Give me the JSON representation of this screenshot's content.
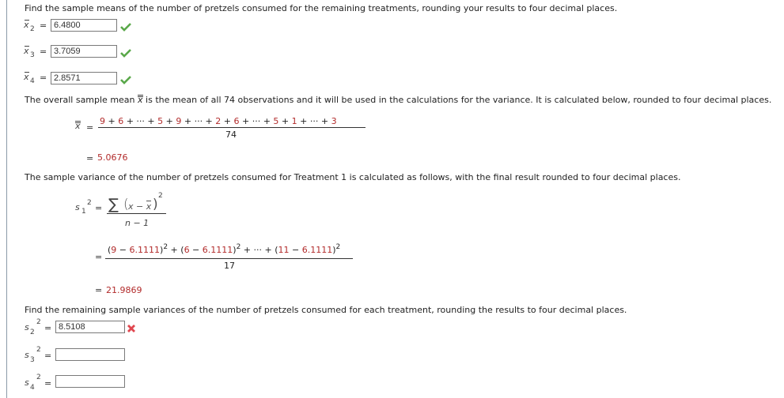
{
  "frame": {
    "border_color": "#8a9aa8"
  },
  "means_section": {
    "instruction": "Find the sample means of the number of pretzels consumed for the remaining treatments, rounding your results to four decimal places.",
    "answers": [
      {
        "var": "x",
        "subscript": "2",
        "equals": "=",
        "value": "6.4800",
        "status": "correct",
        "status_icon": "check-icon"
      },
      {
        "var": "x",
        "subscript": "3",
        "equals": "=",
        "value": "3.7059",
        "status": "correct",
        "status_icon": "check-icon"
      },
      {
        "var": "x",
        "subscript": "4",
        "equals": "=",
        "value": "2.8571",
        "status": "correct",
        "status_icon": "check-icon"
      }
    ]
  },
  "overall_mean": {
    "intro_before": "The overall sample mean ",
    "intro_symbol": "x",
    "intro_after": " is the mean of all 74 observations and it will be used in the calculations for the variance. It is calculated below, rounded to four decimal places.",
    "lhs": "x",
    "equals": "=",
    "numerator": [
      {
        "t": "9",
        "c": "red"
      },
      {
        "t": " + ",
        "c": "k"
      },
      {
        "t": "6",
        "c": "red"
      },
      {
        "t": " + ··· + ",
        "c": "k"
      },
      {
        "t": "5",
        "c": "red"
      },
      {
        "t": " + ",
        "c": "k"
      },
      {
        "t": "9",
        "c": "red"
      },
      {
        "t": " + ··· + ",
        "c": "k"
      },
      {
        "t": "2",
        "c": "red"
      },
      {
        "t": " + ",
        "c": "k"
      },
      {
        "t": "6",
        "c": "red"
      },
      {
        "t": " + ··· + ",
        "c": "k"
      },
      {
        "t": "5",
        "c": "red"
      },
      {
        "t": " + ",
        "c": "k"
      },
      {
        "t": "1",
        "c": "red"
      },
      {
        "t": " + ··· + ",
        "c": "k"
      },
      {
        "t": "3",
        "c": "red"
      }
    ],
    "denominator": "74",
    "result_equals": "=",
    "result": "5.0676"
  },
  "variance_treatment1": {
    "intro": "The sample variance of the number of pretzels consumed for Treatment 1 is calculated as follows, with the final result rounded to four decimal places.",
    "lhs_var": "s",
    "lhs_sub": "1",
    "lhs_sup": "2",
    "equals": "=",
    "formula_sigma": "∑",
    "formula_inner": "x − x",
    "formula_sup": "2",
    "formula_denominator": "n − 1",
    "step2_equals": "=",
    "step2_numerator": [
      {
        "t": "(",
        "c": "k"
      },
      {
        "t": "9",
        "c": "red"
      },
      {
        "t": " − ",
        "c": "k"
      },
      {
        "t": "6.1111",
        "c": "red"
      },
      {
        "t": ")",
        "c": "k"
      },
      {
        "t": "2",
        "c": "sup"
      },
      {
        "t": " + (",
        "c": "k"
      },
      {
        "t": "6",
        "c": "red"
      },
      {
        "t": " − ",
        "c": "k"
      },
      {
        "t": "6.1111",
        "c": "red"
      },
      {
        "t": ")",
        "c": "k"
      },
      {
        "t": "2",
        "c": "sup"
      },
      {
        "t": " + ··· + (",
        "c": "k"
      },
      {
        "t": "11",
        "c": "red"
      },
      {
        "t": " − ",
        "c": "k"
      },
      {
        "t": "6.1111",
        "c": "red"
      },
      {
        "t": ")",
        "c": "k"
      },
      {
        "t": "2",
        "c": "sup"
      }
    ],
    "step2_denominator": "17",
    "result_equals": "=",
    "result": "21.9869"
  },
  "variances_section": {
    "instruction": "Find the remaining sample variances of the number of pretzels consumed for each treatment, rounding the results to four decimal places.",
    "answers": [
      {
        "var": "s",
        "subscript": "2",
        "superscript": "2",
        "equals": "=",
        "value": "8.5108",
        "status": "incorrect",
        "status_icon": "x-icon"
      },
      {
        "var": "s",
        "subscript": "3",
        "superscript": "2",
        "equals": "=",
        "value": "",
        "status": "unanswered"
      },
      {
        "var": "s",
        "subscript": "4",
        "superscript": "2",
        "equals": "=",
        "value": "",
        "status": "unanswered"
      }
    ]
  },
  "colors": {
    "highlight_red": "#b22b2b",
    "check_green": "#5aa84a",
    "x_red": "#e0474f"
  }
}
